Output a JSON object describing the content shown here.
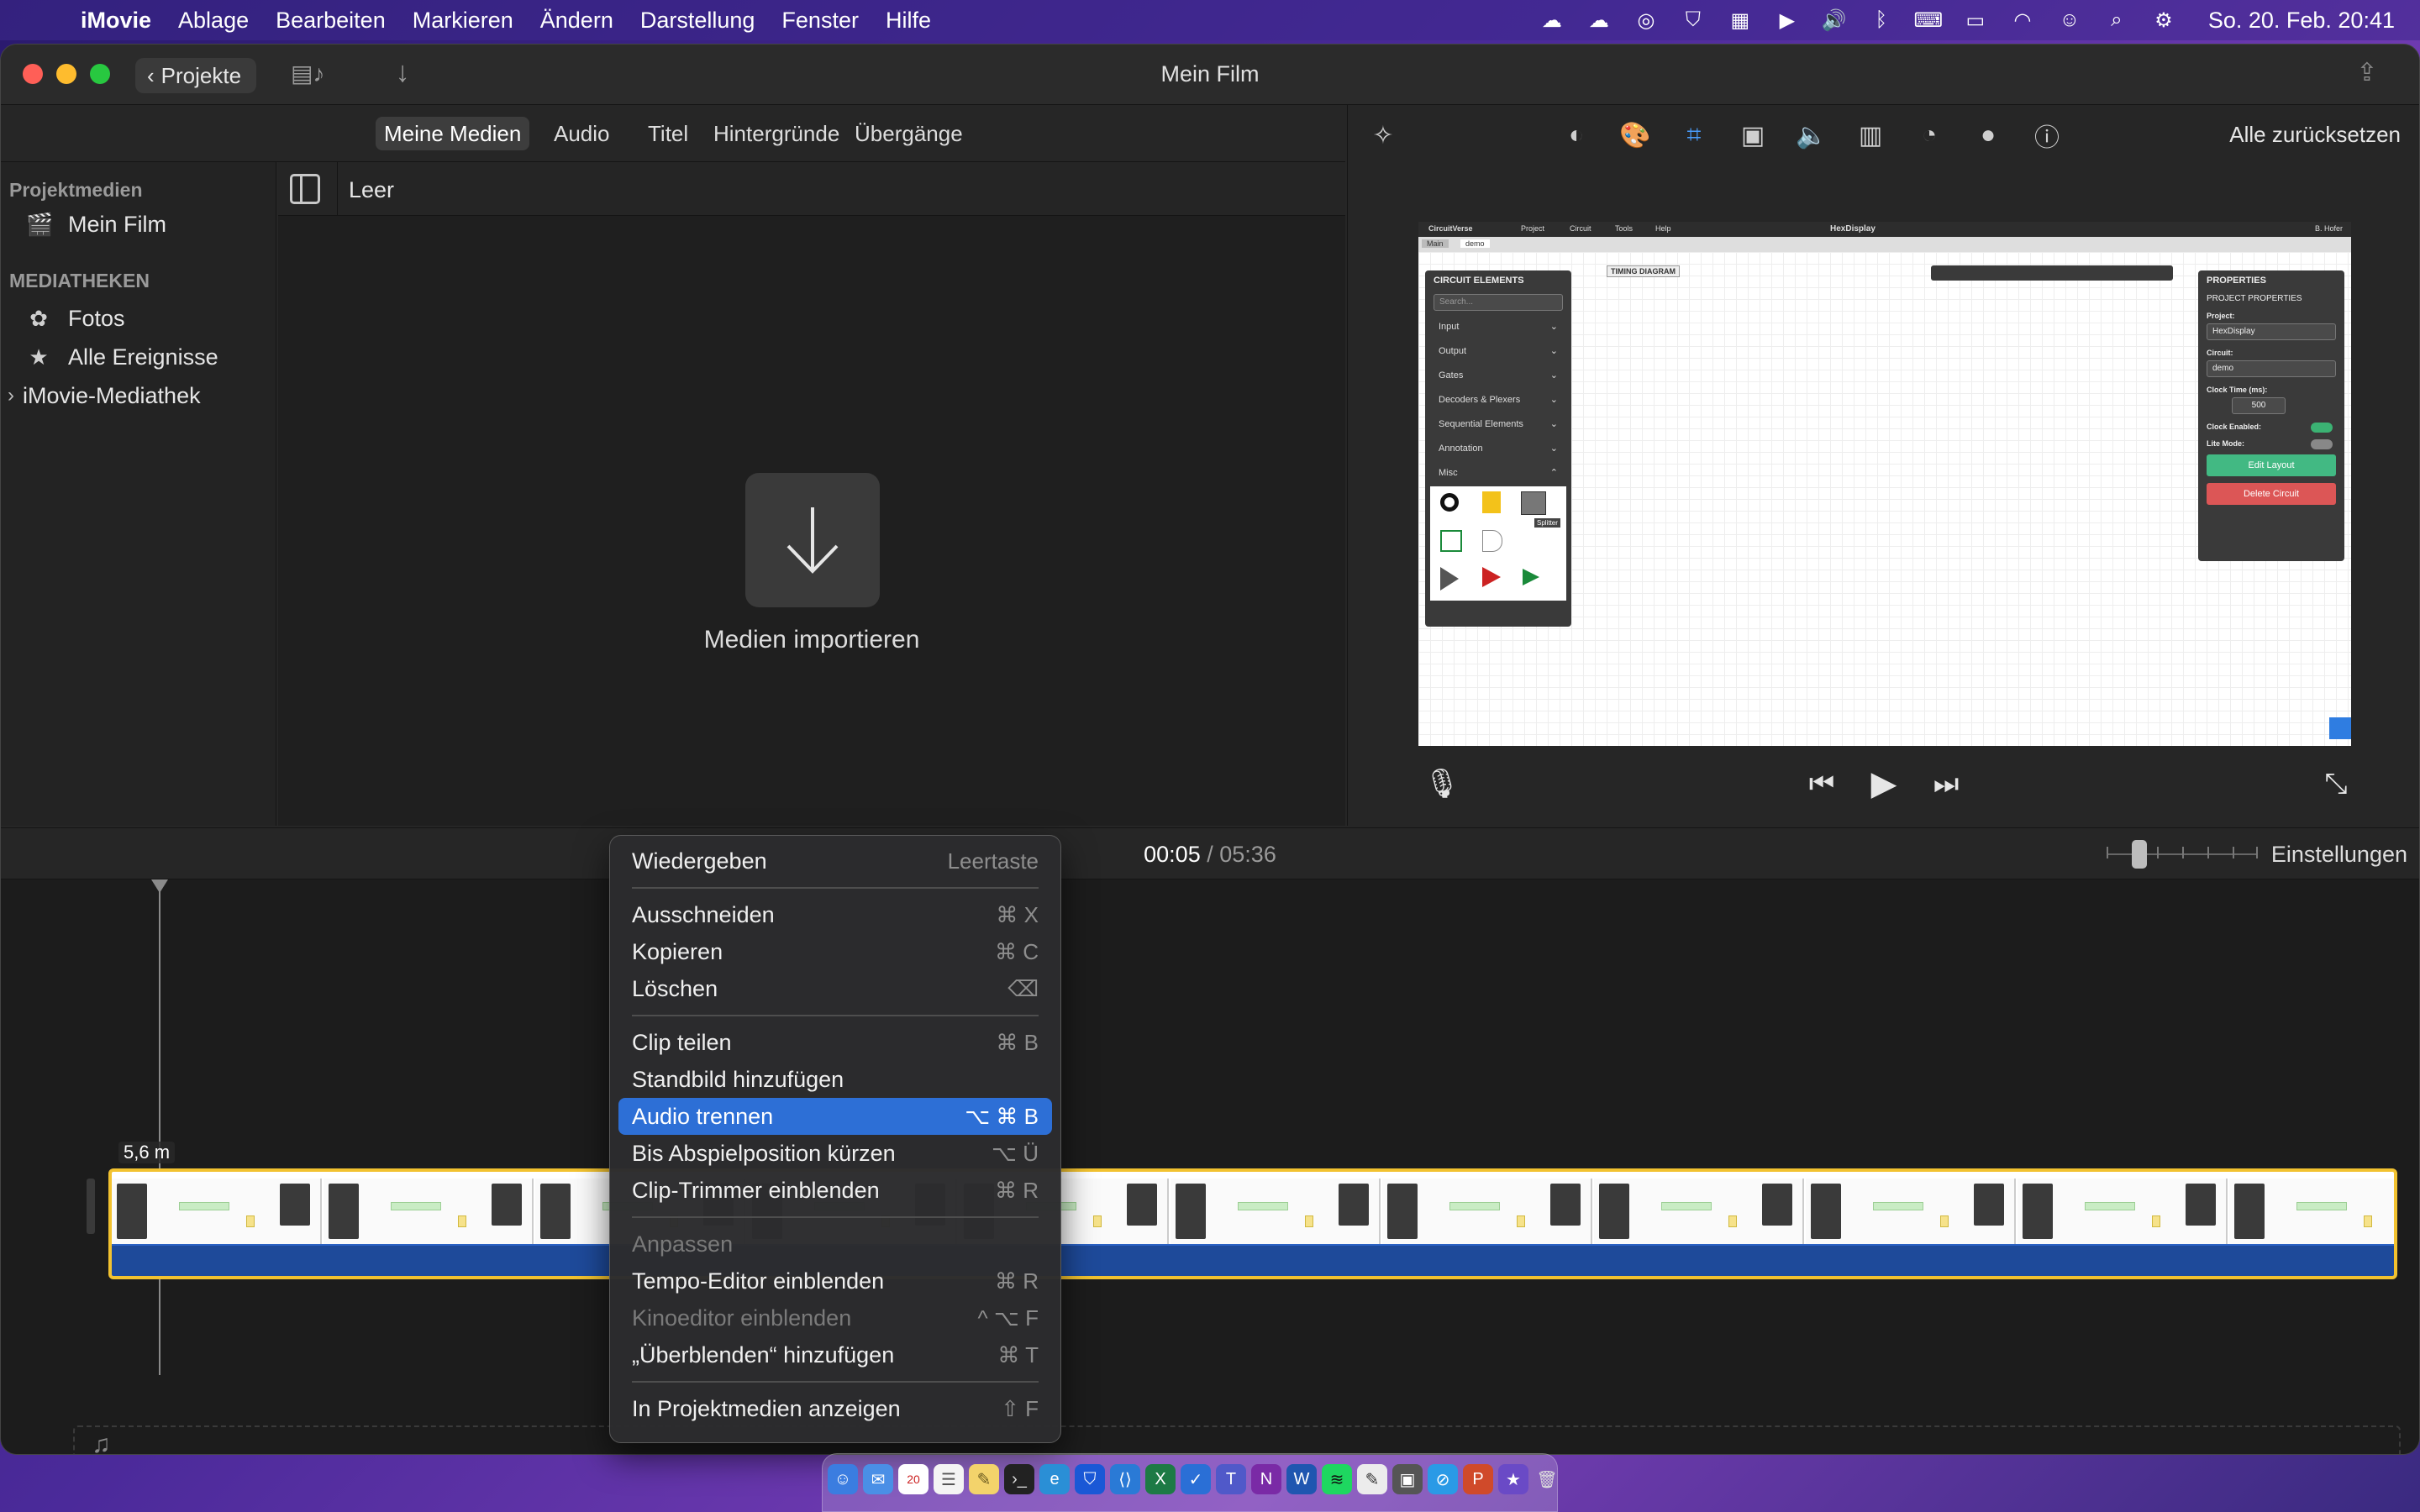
{
  "menubar": {
    "apple": "",
    "app_name": "iMovie",
    "items": [
      "Ablage",
      "Bearbeiten",
      "Markieren",
      "Ändern",
      "Darstellung",
      "Fenster",
      "Hilfe"
    ],
    "clock": "So. 20. Feb.  20:41"
  },
  "window": {
    "title": "Mein Film",
    "projects_button": "Projekte"
  },
  "browser": {
    "tabs": [
      "Meine Medien",
      "Audio",
      "Titel",
      "Hintergründe",
      "Übergänge"
    ],
    "active_tab": "Meine Medien"
  },
  "sidebar": {
    "project_media_heading": "Projektmedien",
    "project_item": "Mein Film",
    "libraries_heading": "MEDIATHEKEN",
    "library_items": [
      "Fotos",
      "Alle Ereignisse",
      "iMovie-Mediathek"
    ]
  },
  "media": {
    "filter_label": "Leer",
    "import_label": "Medien importieren"
  },
  "viewer": {
    "reset_all": "Alle zurücksetzen",
    "preview": {
      "brand": "CircuitVerse",
      "menus": [
        "Project",
        "Circuit",
        "Tools",
        "Help"
      ],
      "center_title": "HexDisplay",
      "user": "B. Hofer",
      "tabs": [
        "Main",
        "demo"
      ],
      "timing_diagram": "TIMING DIAGRAM",
      "elements_panel": {
        "title": "CIRCUIT ELEMENTS",
        "search_placeholder": "Search...",
        "groups": [
          "Input",
          "Output",
          "Gates",
          "Decoders & Plexers",
          "Sequential Elements",
          "Annotation",
          "Misc"
        ],
        "tooltip": "Splitter"
      },
      "properties_panel": {
        "title": "PROPERTIES",
        "subtitle": "PROJECT PROPERTIES",
        "project_label": "Project:",
        "project_value": "HexDisplay",
        "circuit_label": "Circuit:",
        "circuit_value": "demo",
        "clock_time_label": "Clock Time (ms):",
        "clock_time_value": "500",
        "clock_enabled_label": "Clock Enabled:",
        "lite_mode_label": "Lite Mode:",
        "edit_layout": "Edit Layout",
        "delete_circuit": "Delete Circuit"
      }
    }
  },
  "timebar": {
    "current": "00:05",
    "separator": "/",
    "total": "05:36",
    "settings": "Einstellungen"
  },
  "timeline": {
    "clip_duration": "5,6 m"
  },
  "context_menu": {
    "groups": [
      [
        {
          "label": "Wiedergeben",
          "shortcut": "Leertaste",
          "disabled": false
        }
      ],
      [
        {
          "label": "Ausschneiden",
          "shortcut": "⌘ X",
          "disabled": false
        },
        {
          "label": "Kopieren",
          "shortcut": "⌘ C",
          "disabled": false
        },
        {
          "label": "Löschen",
          "shortcut": "⌫",
          "disabled": false
        }
      ],
      [
        {
          "label": "Clip teilen",
          "shortcut": "⌘ B",
          "disabled": false
        },
        {
          "label": "Standbild hinzufügen",
          "shortcut": "",
          "disabled": false
        },
        {
          "label": "Audio trennen",
          "shortcut": "⌥ ⌘ B",
          "disabled": false,
          "selected": true
        },
        {
          "label": "Bis Abspielposition kürzen",
          "shortcut": "⌥ Ü",
          "disabled": false
        },
        {
          "label": "Clip-Trimmer einblenden",
          "shortcut": "⌘ R",
          "disabled": false
        }
      ],
      [
        {
          "label": "Anpassen",
          "shortcut": "",
          "disabled": true
        },
        {
          "label": "Tempo-Editor einblenden",
          "shortcut": "⌘ R",
          "disabled": false
        },
        {
          "label": "Kinoeditor einblenden",
          "shortcut": "^ ⌥ F",
          "disabled": true
        },
        {
          "label": "„Überblenden“ hinzufügen",
          "shortcut": "⌘ T",
          "disabled": false
        }
      ],
      [
        {
          "label": "In Projektmedien anzeigen",
          "shortcut": "⇧ F",
          "disabled": false
        }
      ]
    ]
  },
  "colors": {
    "accent": "#2d6fd6",
    "clip_border": "#f2c230",
    "audio_strip": "#1e4a9a"
  }
}
